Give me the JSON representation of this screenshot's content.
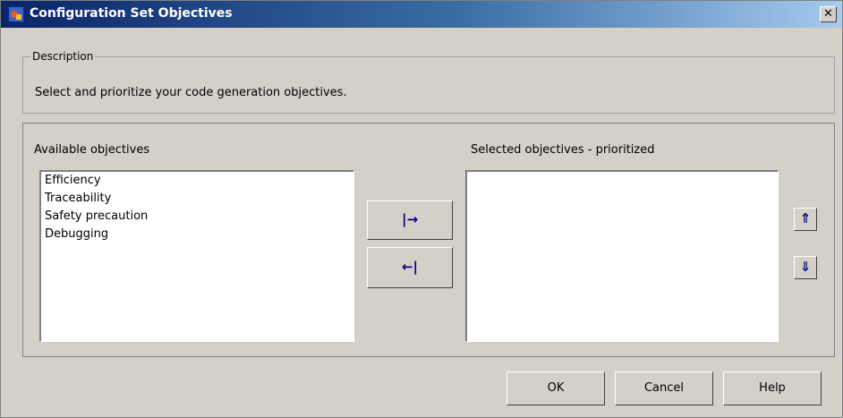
{
  "window": {
    "title": "Configuration Set Objectives",
    "close_glyph": "✕"
  },
  "description": {
    "legend": "Description",
    "text": "Select and prioritize your code generation objectives."
  },
  "available": {
    "label": "Available objectives",
    "items": [
      "Efficiency",
      "Traceability",
      "Safety precaution",
      "Debugging"
    ]
  },
  "selected": {
    "label": "Selected objectives - prioritized",
    "items": []
  },
  "transfer": {
    "add_glyph": "|→",
    "remove_glyph": "←|"
  },
  "priority": {
    "up_glyph": "⇑",
    "down_glyph": "⇓"
  },
  "icons": {
    "add": "arrow-right-to-bar-icon",
    "remove": "arrow-left-from-bar-icon",
    "up": "move-up-icon",
    "down": "move-down-icon"
  },
  "buttons": {
    "ok": "OK",
    "cancel": "Cancel",
    "help": "Help"
  },
  "colors": {
    "titlebar_start": "#0a246a",
    "titlebar_end": "#a6caf0",
    "dialog_bg": "#d4d0c8",
    "glyph": "#000080"
  }
}
